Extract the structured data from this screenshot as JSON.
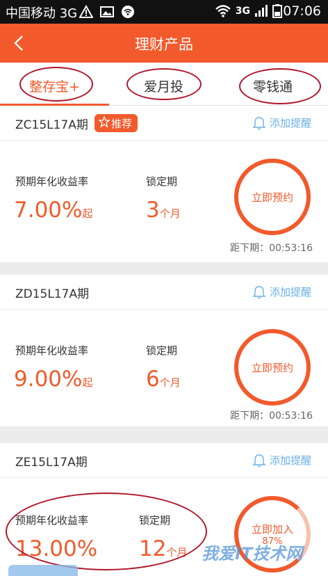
{
  "status_bar": {
    "carrier": "中国移动 3G",
    "network": "3G",
    "time": "07:06"
  },
  "header": {
    "title": "理财产品",
    "back_icon": "chevron-left-icon"
  },
  "tabs": [
    {
      "label": "整存宝+",
      "active": true
    },
    {
      "label": "爱月投",
      "active": false
    },
    {
      "label": "零钱通",
      "active": false
    }
  ],
  "products": [
    {
      "code": "ZC15L17A期",
      "badge": "推荐",
      "remind": "添加提醒",
      "rate_label": "预期年化收益率",
      "rate": "7.00%",
      "rate_suffix": "起",
      "lock_label": "锁定期",
      "lock_value": "3",
      "lock_unit": "个月",
      "action": "立即预约",
      "countdown": "距下期：00:53:16"
    },
    {
      "code": "ZD15L17A期",
      "remind": "添加提醒",
      "rate_label": "预期年化收益率",
      "rate": "9.00%",
      "rate_suffix": "起",
      "lock_label": "锁定期",
      "lock_value": "6",
      "lock_unit": "个月",
      "action": "立即预约",
      "countdown": "距下期：00:53:16"
    },
    {
      "code": "ZE15L17A期",
      "remind": "添加提醒",
      "rate_label": "预期年化收益率",
      "rate": "13.00%",
      "lock_label": "锁定期",
      "lock_value": "12",
      "lock_unit": "个月",
      "action": "立即加入",
      "progress_text": "87%",
      "progress": 0.87
    }
  ],
  "watermark": "我爱IT技术网",
  "colors": {
    "accent": "#f25a2c",
    "link": "#6ab0e6",
    "annotation": "#b0162a"
  }
}
